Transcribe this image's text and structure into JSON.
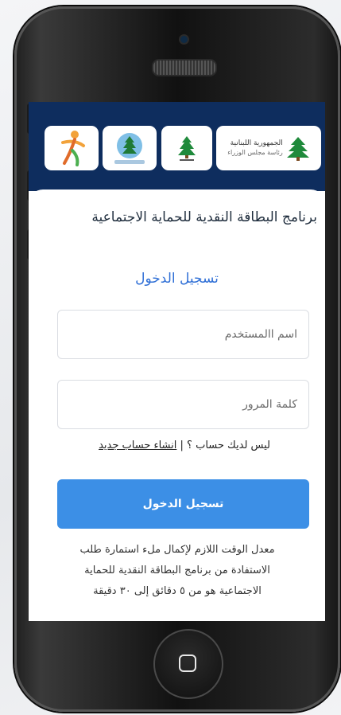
{
  "app": {
    "title": "برنامج البطاقة النقدية للحماية الاجتماعية",
    "login_heading": "تسجيل الدخول"
  },
  "logos": [
    {
      "name": "lebanese-republic-logo",
      "caption_line1": "الجمهورية اللبنانية",
      "caption_line2": "رئاسة مجلس الوزراء"
    },
    {
      "name": "cedar-emblem-logo"
    },
    {
      "name": "ministry-emblem-logo"
    },
    {
      "name": "stick-figure-logo"
    }
  ],
  "form": {
    "username_placeholder": "اسم االمستخدم",
    "password_placeholder": "كلمة المرور",
    "no_account_text": "ليس لديك حساب ؟",
    "separator": "|",
    "signup_link": "انشاء حساب جديد",
    "login_button": "تسجيل الدخول"
  },
  "note": {
    "line1": "معدل الوقت اللازم لإكمال ملء استمارة طلب",
    "line2": "الاستفادة من برنامج البطاقة النقدية للحماية",
    "line3": "الاجتماعية هو من ٥ دقائق إلى ٣٠ دقيقة"
  },
  "colors": {
    "header_bg": "#0e2d5e",
    "accent": "#3c8fe6",
    "heading_blue": "#2f6fd6"
  }
}
